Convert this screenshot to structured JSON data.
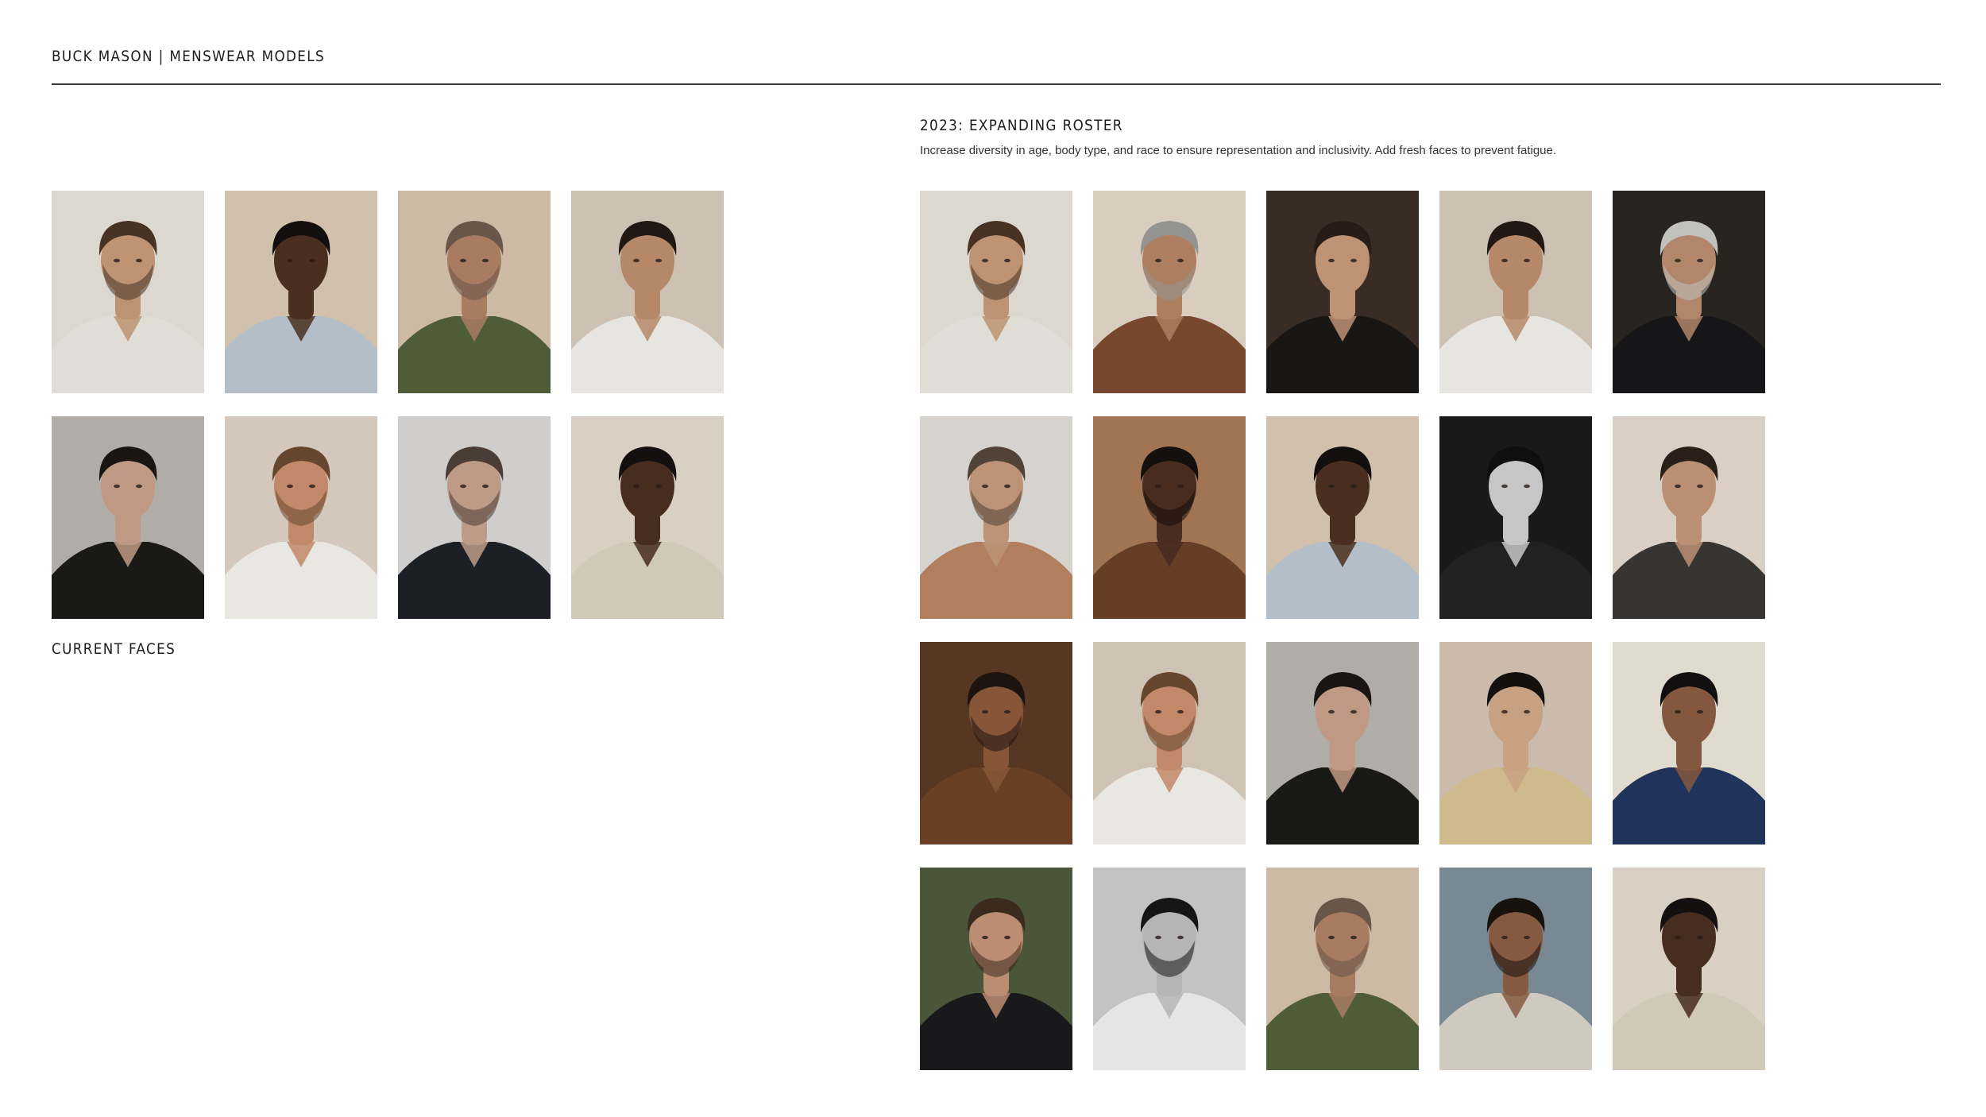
{
  "header": {
    "title": "BUCK MASON | MENSWEAR MODELS"
  },
  "current": {
    "label": "CURRENT FACES",
    "photos": [
      {
        "name": "model-photo",
        "bg": "#e7e1d8",
        "skin": "#c59a78",
        "hair": "#4a3526",
        "shirt": "#e9e6df",
        "beard": true
      },
      {
        "name": "model-photo",
        "bg": "#d9c8b4",
        "skin": "#4e3122",
        "hair": "#141010",
        "shirt": "#bcc6d2",
        "beard": false
      },
      {
        "name": "model-photo",
        "bg": "#d5c2ac",
        "skin": "#b08266",
        "hair": "#6e5a4c",
        "shirt": "#53603b",
        "beard": true
      },
      {
        "name": "model-photo",
        "bg": "#d6c9bb",
        "skin": "#bd8e6e",
        "hair": "#241a14",
        "shirt": "#f1efea",
        "beard": false
      },
      {
        "name": "model-photo",
        "bg": "#b8b4ae",
        "skin": "#c7a08a",
        "hair": "#1c1612",
        "shirt": "#1b1b17",
        "beard": false
      },
      {
        "name": "model-photo",
        "bg": "#ddd0c4",
        "skin": "#c98e6e",
        "hair": "#6b4a30",
        "shirt": "#f3f1ec",
        "beard": true
      },
      {
        "name": "model-photo",
        "bg": "#d9d7d5",
        "skin": "#c6a28c",
        "hair": "#4e4038",
        "shirt": "#1f2128",
        "beard": true
      },
      {
        "name": "model-photo",
        "bg": "#e3d8cb",
        "skin": "#4a2e22",
        "hair": "#161110",
        "shirt": "#d9d2c0",
        "beard": false
      }
    ]
  },
  "roster": {
    "title": "2023: EXPANDING ROSTER",
    "description": "Increase diversity in age, body type, and race to ensure representation and inclusivity. Add fresh faces to prevent fatigue.",
    "photos": [
      {
        "name": "model-photo",
        "bg": "#e7e1d8",
        "skin": "#c59a78",
        "hair": "#4a3526",
        "shirt": "#e9e6df",
        "beard": true
      },
      {
        "name": "model-photo",
        "bg": "#e2d6c8",
        "skin": "#b58463",
        "hair": "#9a9a98",
        "shirt": "#7c4a30",
        "beard": true
      },
      {
        "name": "model-photo",
        "bg": "#3c2e26",
        "skin": "#c6987a",
        "hair": "#2a1e17",
        "shirt": "#1a1816",
        "beard": false
      },
      {
        "name": "model-photo",
        "bg": "#d6c9bb",
        "skin": "#bd8e6e",
        "hair": "#241a14",
        "shirt": "#f1efea",
        "beard": false
      },
      {
        "name": "model-photo",
        "bg": "#2a2622",
        "skin": "#b98c70",
        "hair": "#c9c9c5",
        "shirt": "#17171a",
        "beard": true
      },
      {
        "name": "model-photo",
        "bg": "#dfdcd8",
        "skin": "#c49a7c",
        "hair": "#55463b",
        "shirt": "#b98562",
        "beard": true
      },
      {
        "name": "model-photo",
        "bg": "#a87a58",
        "skin": "#4b2e21",
        "hair": "#17110e",
        "shirt": "#6b4128",
        "beard": true
      },
      {
        "name": "model-photo",
        "bg": "#d9c8b4",
        "skin": "#4e3122",
        "hair": "#141010",
        "shirt": "#bcc6d2",
        "beard": false
      },
      {
        "name": "model-photo",
        "bg": "#1b1b1b",
        "skin": "#cfcfcf",
        "hair": "#101010",
        "shirt": "#232323",
        "beard": false
      },
      {
        "name": "model-photo",
        "bg": "#e2d8cc",
        "skin": "#c39578",
        "hair": "#2b2019",
        "shirt": "#3a3835",
        "beard": false
      },
      {
        "name": "model-photo",
        "bg": "#5c3a24",
        "skin": "#8d5a3c",
        "hair": "#1f1410",
        "shirt": "#6e4326",
        "beard": true
      },
      {
        "name": "model-photo",
        "bg": "#d8cbbd",
        "skin": "#c98e6e",
        "hair": "#6b4a30",
        "shirt": "#f3f1ec",
        "beard": true
      },
      {
        "name": "model-photo",
        "bg": "#b8b4ae",
        "skin": "#c7a08a",
        "hair": "#1c1612",
        "shirt": "#1b1b17",
        "beard": false
      },
      {
        "name": "model-photo",
        "bg": "#d3c3b4",
        "skin": "#d1a888",
        "hair": "#15110f",
        "shirt": "#d8c293",
        "beard": false
      },
      {
        "name": "model-photo",
        "bg": "#ebe4d8",
        "skin": "#8a5c42",
        "hair": "#121010",
        "shirt": "#22365e",
        "beard": false
      },
      {
        "name": "model-photo",
        "bg": "#4f5a3c",
        "skin": "#c49378",
        "hair": "#3e2c20",
        "shirt": "#1b1b1d",
        "beard": true
      },
      {
        "name": "model-photo",
        "bg": "#cbcbcb",
        "skin": "#bdbdbd",
        "hair": "#161616",
        "shirt": "#efefef",
        "beard": true
      },
      {
        "name": "model-photo",
        "bg": "#d5c2ac",
        "skin": "#b08266",
        "hair": "#6e5a4c",
        "shirt": "#53603b",
        "beard": true
      },
      {
        "name": "model-photo",
        "bg": "#7d8f9a",
        "skin": "#8c5e44",
        "hair": "#1a1310",
        "shirt": "#d8d3c8",
        "beard": true
      },
      {
        "name": "model-photo",
        "bg": "#e3d8cb",
        "skin": "#4a2e22",
        "hair": "#161110",
        "shirt": "#d9d2c0",
        "beard": false
      }
    ]
  }
}
